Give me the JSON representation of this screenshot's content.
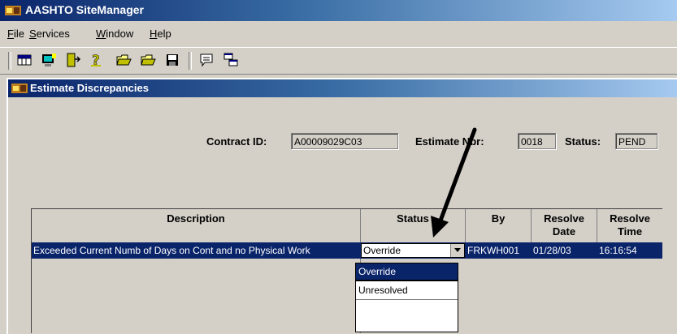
{
  "app": {
    "title": "AASHTO SiteManager"
  },
  "menu": [
    {
      "label": "File",
      "underline": "F",
      "rest": "ile"
    },
    {
      "label": "Services",
      "underline": "S",
      "rest": "ervices"
    },
    {
      "label": "Window",
      "underline": "W",
      "rest": "indow"
    },
    {
      "label": "Help",
      "underline": "H",
      "rest": "elp"
    }
  ],
  "toolbar_icons": [
    "grid-icon",
    "monitor-icon",
    "exit-door-icon",
    "help-question-icon",
    "open-folder-icon",
    "open-folder-alt-icon",
    "save-disk-icon",
    "comment-bubble-icon",
    "cascade-windows-icon"
  ],
  "window": {
    "title": "Estimate Discrepancies",
    "contract_label": "Contract ID:",
    "contract_value": "A00009029C03",
    "estimate_label": "Estimate Nbr:",
    "estimate_value": "0018",
    "status_label": "Status:",
    "status_value": "PEND"
  },
  "grid": {
    "headers": {
      "description": "Description",
      "status": "Status",
      "by": "By",
      "resolve_date": "Resolve Date",
      "resolve_time": "Resolve Time"
    },
    "rows": [
      {
        "description": "Exceeded Current Numb of Days on Cont and no Physical Work",
        "status": "Override",
        "by": "FRKWH001",
        "resolve_date": "01/28/03",
        "resolve_time": "16:16:54"
      }
    ]
  },
  "dropdown": {
    "options": [
      "Override",
      "Unresolved"
    ],
    "selected": "Override"
  },
  "colors": {
    "titlebar": "#0a246a",
    "selection": "#0a246a",
    "face": "#d4d0c8"
  }
}
